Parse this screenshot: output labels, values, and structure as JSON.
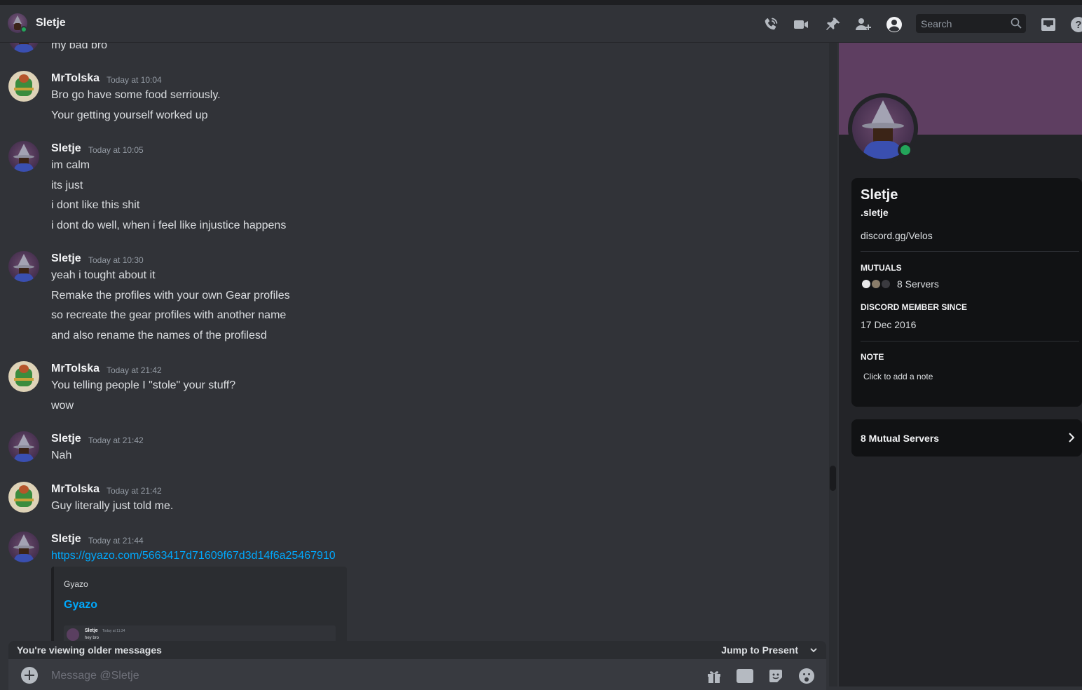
{
  "header": {
    "dm_name": "Sletje",
    "search_placeholder": "Search",
    "icons": [
      "phone-call-icon",
      "video-call-icon",
      "pin-icon",
      "add-friend-icon",
      "profile-toggle-icon",
      "search-icon",
      "inbox-icon",
      "help-icon"
    ]
  },
  "messages": {
    "partial_line": "my bad bro",
    "groups": [
      {
        "author": "MrTolska",
        "timestamp": "Today at 10:04",
        "lines": [
          "Bro go have some food serriously.",
          "Your getting yourself worked up"
        ]
      },
      {
        "author": "Sletje",
        "timestamp": "Today at 10:05",
        "lines": [
          "im calm",
          "its just",
          "i dont like this shit",
          "i dont do well, when i feel like injustice happens"
        ]
      },
      {
        "author": "Sletje",
        "timestamp": "Today at 10:30",
        "lines": [
          "yeah i tought about it",
          "Remake the profiles with your own Gear profiles",
          "so recreate the gear profiles with another name",
          "and also rename the names of the profilesd"
        ]
      },
      {
        "author": "MrTolska",
        "timestamp": "Today at 21:42",
        "lines": [
          "You telling people I \"stole\" your stuff?",
          "wow"
        ]
      },
      {
        "author": "Sletje",
        "timestamp": "Today at 21:42",
        "lines": [
          "Nah"
        ]
      },
      {
        "author": "MrTolska",
        "timestamp": "Today at 21:42",
        "lines": [
          "Guy literally just told me."
        ]
      },
      {
        "author": "Sletje",
        "timestamp": "Today at 21:44",
        "lines": [
          "https://gyazo.com/5663417d71609f67d3d14f6a25467910"
        ]
      }
    ],
    "embed": {
      "provider": "Gyazo",
      "title": "Gyazo",
      "thumb_name": "Sletje",
      "thumb_ts": "Today at 11:34",
      "thumb_msg": "hey bro"
    }
  },
  "composer": {
    "older_notice": "You're viewing older messages",
    "jump_label": "Jump to Present",
    "placeholder": "Message @Sletje",
    "icons": [
      "add-attachment-icon",
      "gift-icon",
      "gif-icon",
      "sticker-icon",
      "emoji-icon"
    ],
    "gif_label": "GIF"
  },
  "profile": {
    "display_name": "Sletje",
    "username": ".sletje",
    "bio": "discord.gg/Velos",
    "mutuals_heading": "MUTUALS",
    "mutuals_text": "8 Servers",
    "member_since_heading": "DISCORD MEMBER SINCE",
    "member_since": "17 Dec 2016",
    "note_heading": "NOTE",
    "note_placeholder": "Click to add a note",
    "mutual_servers_button": "8 Mutual Servers",
    "banner_color": "#5e3e61",
    "status_color": "#23a55a"
  }
}
